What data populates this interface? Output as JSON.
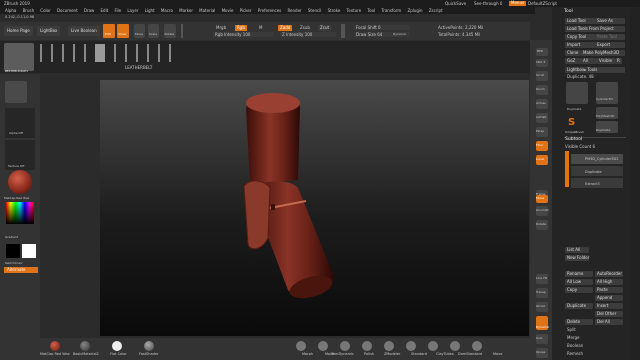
{
  "title": "ZBrush 2019 ",
  "title_right": [
    "QuickSave",
    "See-through 0",
    "Menus",
    "DefaultZScript"
  ],
  "menu": [
    "Alpha",
    "Brush",
    "Color",
    "Document",
    "Draw",
    "Edit",
    "File",
    "Layer",
    "Light",
    "Macro",
    "Marker",
    "Material",
    "Movie",
    "Picker",
    "Preferences",
    "Render",
    "Stencil",
    "Stroke",
    "Texture",
    "Tool",
    "Transform",
    "Zplugin",
    "Zscript"
  ],
  "coords": "0.242,-0.11,0.98",
  "toolbar": {
    "home": "Home Page",
    "lightbox": "LightBox",
    "live_boolean": "Live Boolean",
    "edit": "Edit",
    "draw": "Draw",
    "move": "Move",
    "scale": "Scale",
    "rotate": "Rotate",
    "mrgb": "Mrgb",
    "rgb": "Rgb",
    "m": "M",
    "rgb_intensity": "Rgb Intensity 100",
    "zadd": "Zadd",
    "zsub": "Zsub",
    "zcut": "Zcut",
    "z_intensity": "Z Intensity 100",
    "focal_shift": "Focal Shift 0",
    "draw_size": "Draw Size 64",
    "dynamic": "Dynamic",
    "active_points": "ActivePoints: 2,220 Mil",
    "total_points": "TotalPoints: 4.345 Mil"
  },
  "brush_strip_label": "LEATHERBELT",
  "left": {
    "brush": "BELTHBUCKLE1",
    "alpha": "Alpha Off",
    "texture": "Texture Off",
    "material": "MatCap Red Wax",
    "gradient": "Gradient",
    "switch_color": "SwitchColor",
    "alternate": "Alternate"
  },
  "mid_right": [
    "BPR",
    "SPix 3",
    "Scroll",
    "Zoom",
    "Actual",
    "AAHalf",
    "Persp",
    "Floor",
    "Local",
    "Frame",
    "Move",
    "Zoom3D",
    "Rotate",
    "Line Fill",
    "Transp",
    "Ghost",
    "Dynamic",
    "Solo",
    "Xpose"
  ],
  "tool": {
    "header": "Tool",
    "load_tool": "Load Tool",
    "save_as": "Save As",
    "load_project": "Load Tools From Project",
    "copy_tool": "Copy Tool",
    "paste_tool": "Paste Tool",
    "import": "Import",
    "export": "Export",
    "clone": "Clone",
    "make_polymesh": "Make PolyMesh3D",
    "goz": "GoZ",
    "all": "All",
    "visible": "Visible",
    "r": "R",
    "lightbox_tools": "Lightbox▸ Tools",
    "duplicate_label": "Duplicate. 48",
    "thumbs": [
      "Cylinder3D",
      "Duplicate",
      "PolyMesh3D",
      "SimpleBrush",
      "Duplicate"
    ],
    "subtool_header": "Subtool",
    "visible_count": "Visible Count 6",
    "subtools": [
      "PM3D_Cylinder3D2",
      "Duplicate",
      "Extract3"
    ],
    "list_all": "List All",
    "new_folder": "New Folder",
    "rename": "Rename",
    "autoreorder": "AutoReorder",
    "all_low": "All Low",
    "all_high": "All High",
    "copy": "Copy",
    "paste": "Paste",
    "append": "Append",
    "duplicate": "Duplicate",
    "insert": "Insert",
    "del_other": "Del Other",
    "delete": "Delete",
    "del_all": "Del All",
    "split": "Split",
    "merge": "Merge",
    "boolean": "Boolean",
    "remesh": "Remesh"
  },
  "bottom": {
    "materials": [
      "MatCap Red Wax",
      "BasicMaterial2",
      "Flat Color",
      "FastShader"
    ],
    "brushes": [
      "Morph",
      "Move",
      "TrimDynamic",
      "Polish",
      "ZModeler",
      "Standard",
      "ClayTubes",
      "DamStandard",
      "Move"
    ]
  },
  "colors": {
    "accent": "#e07316",
    "model": "#7a2a1f",
    "background_top": "#4a4a4a",
    "background_bottom": "#0a0a0a"
  }
}
